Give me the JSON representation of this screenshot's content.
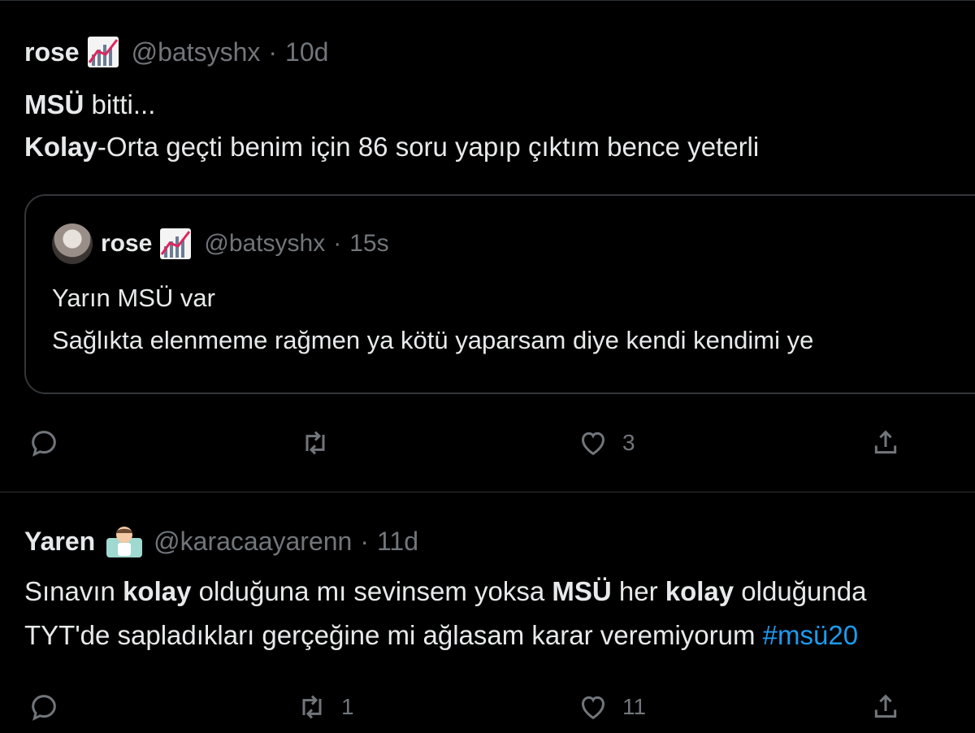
{
  "tweets": [
    {
      "name": "rose",
      "handle": "@batsyshx",
      "dot": "·",
      "time": "10d",
      "body_line1_bold": "MSÜ",
      "body_line1_rest": " bitti...",
      "body_line2_bold": "Kolay",
      "body_line2_rest": "-Orta geçti benim için 86 soru yapıp çıktım bence yeterli",
      "quote": {
        "name": "rose",
        "handle": "@batsyshx",
        "dot": "·",
        "time": "15s",
        "line1": "Yarın MSÜ var",
        "line2": "Sağlıkta elenmeme rağmen ya kötü yaparsam diye kendi kendimi ye"
      },
      "actions": {
        "reply": "",
        "retweet": "",
        "like": "3",
        "share": ""
      }
    },
    {
      "name": "Yaren",
      "handle": "@karacaayarenn",
      "dot": "·",
      "time": "11d",
      "line1_parts": [
        "Sınavın ",
        "kolay",
        " olduğuna mı sevinsem yoksa ",
        "MSÜ",
        " her ",
        "kolay",
        " olduğunda"
      ],
      "line2_text": "TYT'de sapladıkları gerçeğine mi ağlasam karar veremiyorum ",
      "line2_hashtag": "#msü20",
      "actions": {
        "reply": "",
        "retweet": "1",
        "like": "11",
        "share": ""
      }
    }
  ],
  "colors": {
    "background": "#000000",
    "text": "#e7e9ea",
    "muted": "#71767b",
    "hashtag": "#1d9bf0",
    "border": "#2f3336"
  },
  "icons": [
    "reply-icon",
    "retweet-icon",
    "like-icon",
    "share-icon",
    "chart-emoji-icon",
    "person-emoji-icon"
  ]
}
